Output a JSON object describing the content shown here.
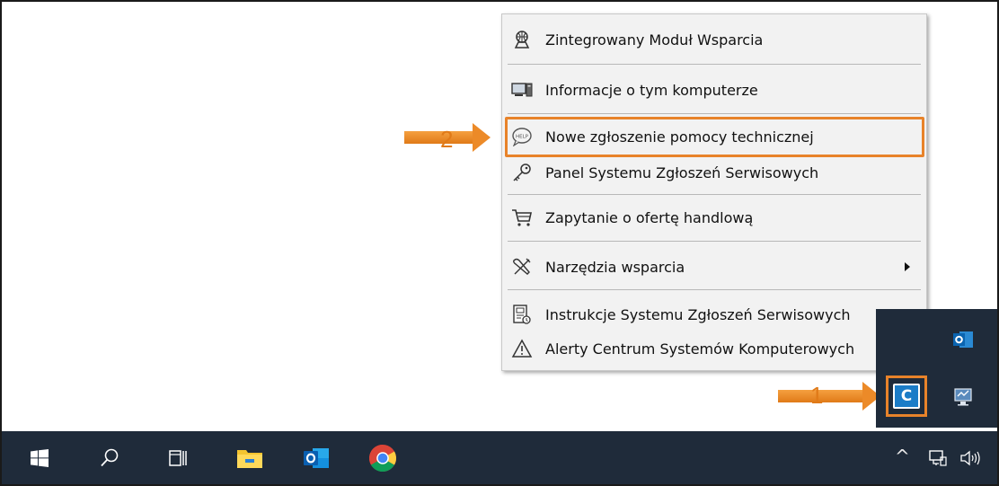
{
  "context_menu": {
    "items": [
      {
        "label": "Zintegrowany Moduł Wsparcia",
        "icon": "support-module-icon"
      },
      {
        "label": "Informacje o tym komputerze",
        "icon": "computer-info-icon"
      },
      {
        "label": "Nowe zgłoszenie pomocy technicznej",
        "icon": "help-bubble-icon"
      },
      {
        "label": "Panel Systemu Zgłoszeń Serwisowych",
        "icon": "key-icon"
      },
      {
        "label": "Zapytanie o ofertę handlową",
        "icon": "cart-icon"
      },
      {
        "label": "Narzędzia wsparcia",
        "icon": "tools-icon",
        "has_submenu": true
      },
      {
        "label": "Instrukcje Systemu Zgłoszeń Serwisowych",
        "icon": "manual-icon"
      },
      {
        "label": "Alerty Centrum Systemów Komputerowych",
        "icon": "warning-icon"
      }
    ],
    "highlighted_item": "Nowe zgłoszenie pomocy technicznej"
  },
  "annotations": {
    "step_1": "1",
    "step_2": "2",
    "accent_color": "#e8832a"
  },
  "tray_popup": {
    "app_letter": "C",
    "icons": [
      "outlook-tray-icon",
      "network-monitor-icon",
      "c-app-icon"
    ]
  },
  "taskbar": {
    "background": "#1f2b3a",
    "pinned": [
      "start-button",
      "search-button",
      "task-view-button",
      "file-explorer-button",
      "outlook-button",
      "chrome-button"
    ],
    "system_tray": {
      "chevron": "^",
      "icons": [
        "show-hidden-icons",
        "network-icon",
        "volume-icon"
      ]
    }
  }
}
